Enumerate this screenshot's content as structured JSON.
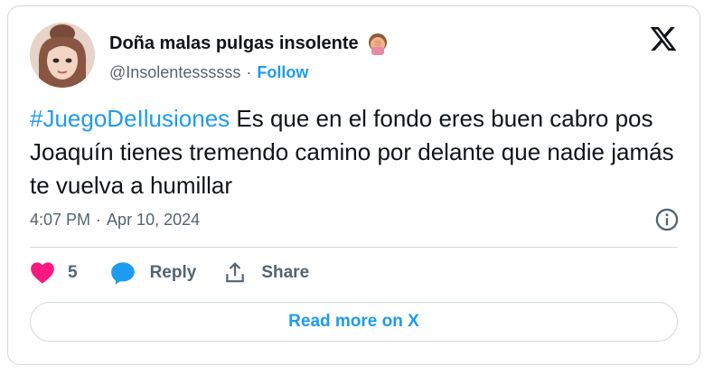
{
  "author": {
    "display_name": "Doña malas pulgas insolente",
    "emoji_icon": "woman-facepalming-emoji",
    "handle": "@Insolentessssss",
    "separator": "·",
    "follow_label": "Follow"
  },
  "tweet": {
    "hashtag": "#JuegoDeIlusiones",
    "text": " Es que en el fondo eres buen cabro pos Joaquín tienes tremendo camino por delante  que nadie jamás te vuelva a humillar",
    "time": "4:07 PM",
    "separator": "·",
    "date": "Apr 10, 2024"
  },
  "actions": {
    "like_count": "5",
    "reply_label": "Reply",
    "share_label": "Share"
  },
  "read_more_label": "Read more on X",
  "colors": {
    "accent": "#1d9bf0",
    "like": "#f91880",
    "text": "#0f1419",
    "secondary": "#536471",
    "border": "#cfd9de"
  }
}
